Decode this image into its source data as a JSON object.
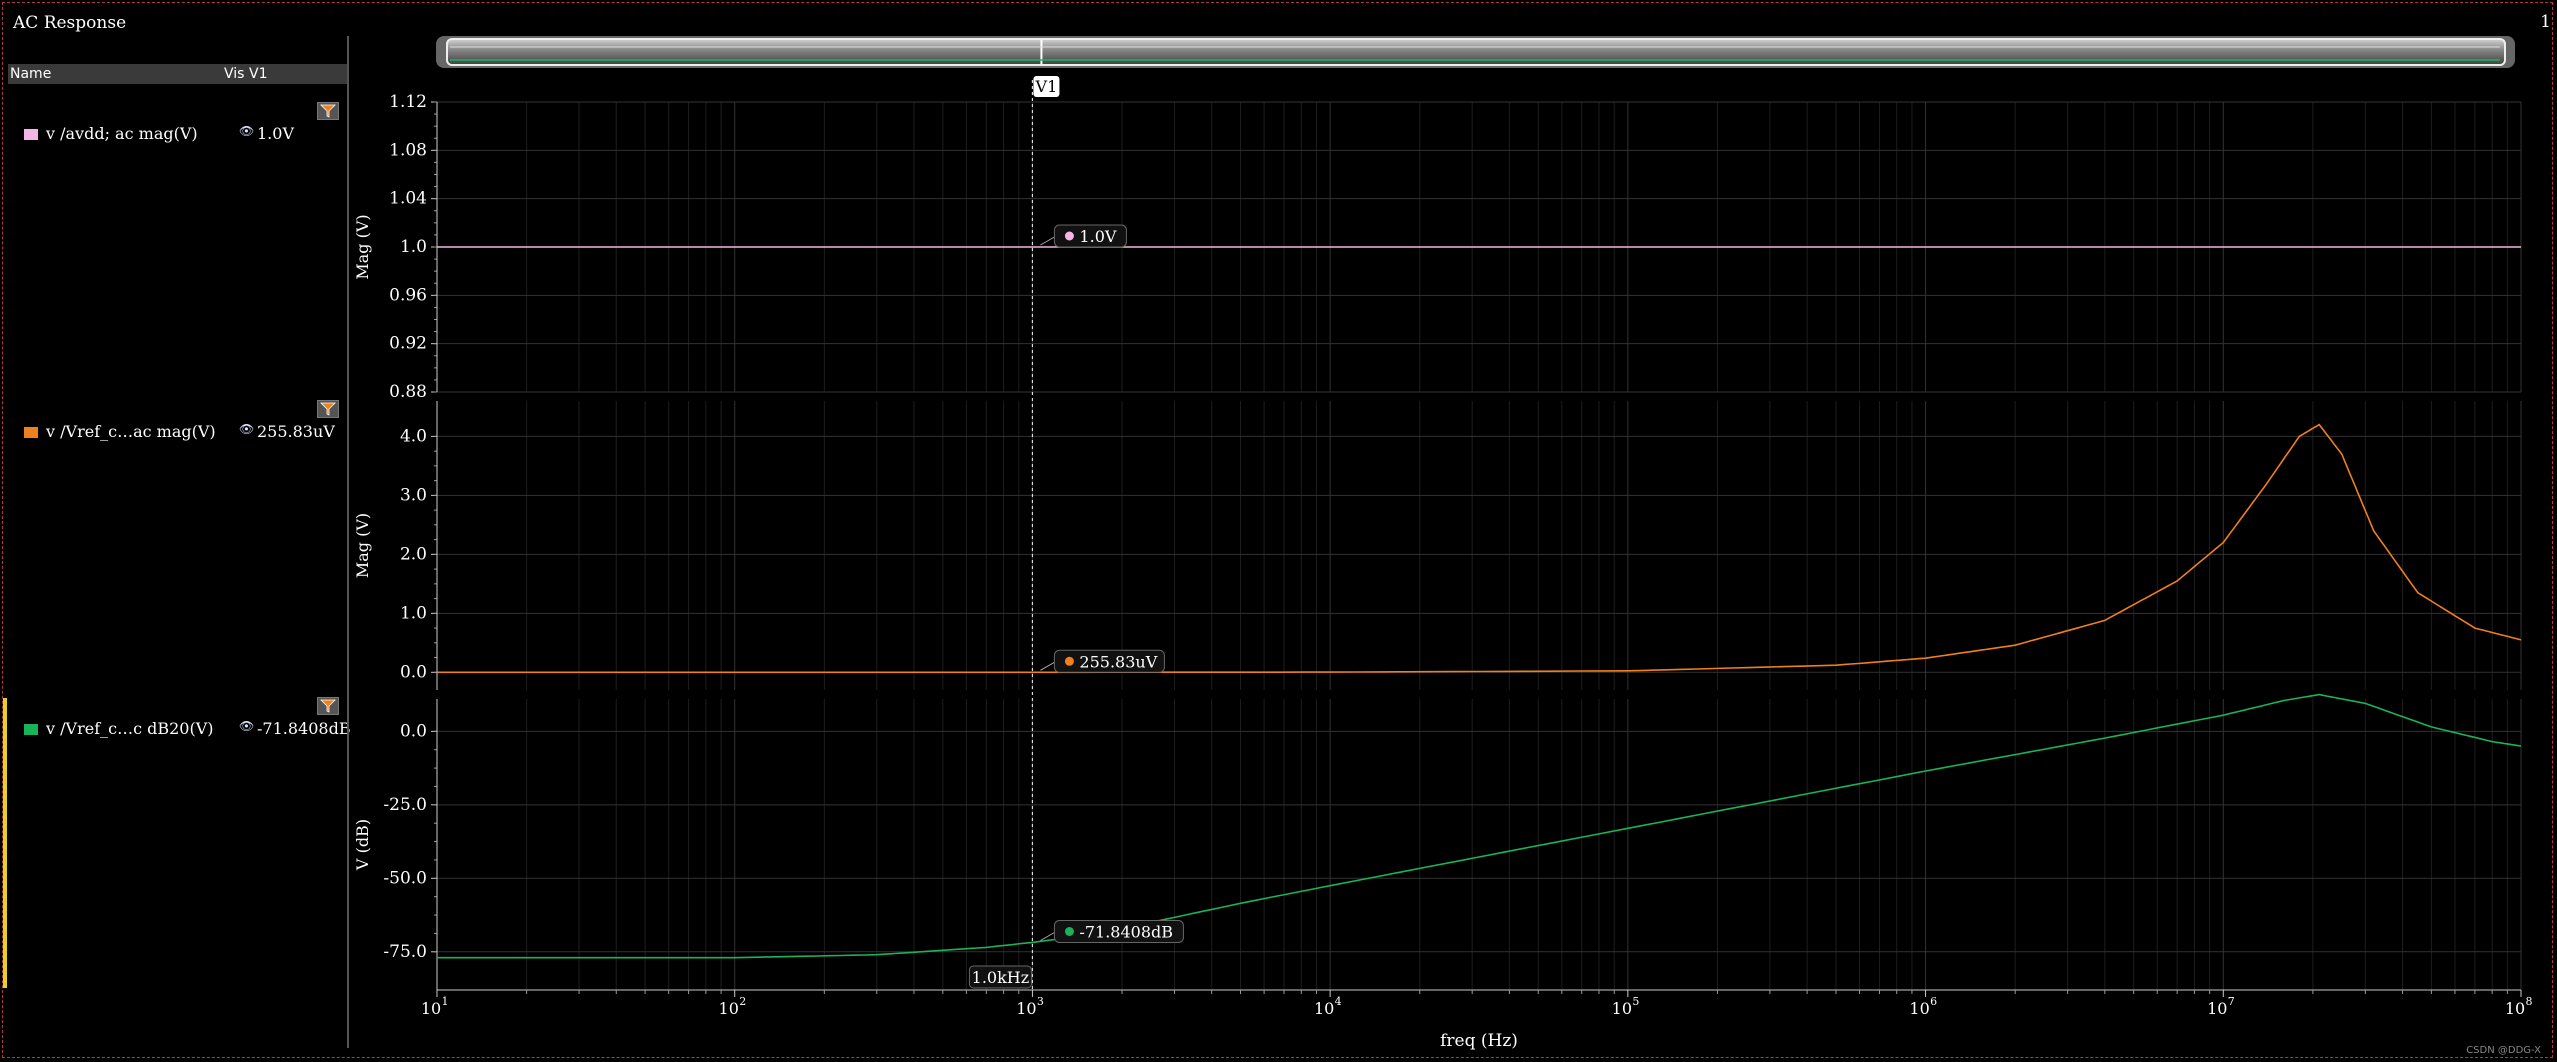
{
  "window": {
    "title": "AC Response",
    "index": "1"
  },
  "panel": {
    "headers": {
      "name": "Name",
      "vis": "Vis",
      "cursor": "V1"
    },
    "signals": [
      {
        "name": "v /avdd; ac mag(V)",
        "value": "1.0V",
        "color": "#f4b6e6"
      },
      {
        "name": "v /Vref_c…ac mag(V)",
        "value": "255.83uV",
        "color": "#f07f1e"
      },
      {
        "name": "v /Vref_c…c dB20(V)",
        "value": "-71.8408dB",
        "color": "#19b35a"
      }
    ]
  },
  "cursor": {
    "name": "V1",
    "x_label": "1.0kHz",
    "x_value": 1000
  },
  "chart_data": [
    {
      "type": "line",
      "ylabel": "Mag (V)",
      "xlabel": "",
      "xscale": "log",
      "xlim": [
        10,
        100000000
      ],
      "ylim": [
        0.88,
        1.12
      ],
      "yticks": [
        "1.12",
        "1.08",
        "1.04",
        "1.0",
        "0.96",
        "0.92",
        "0.88"
      ],
      "ytick_values": [
        1.12,
        1.08,
        1.04,
        1.0,
        0.96,
        0.92,
        0.88
      ],
      "series": [
        {
          "name": "v /avdd; ac mag(V)",
          "color": "#f4b6e6",
          "x": [
            10,
            100,
            1000,
            10000,
            100000,
            1000000,
            10000000,
            100000000
          ],
          "y": [
            1.0,
            1.0,
            1.0,
            1.0,
            1.0,
            1.0,
            1.0,
            1.0
          ]
        }
      ],
      "marker": {
        "label": "1.0V",
        "x": 1000,
        "y": 1.0
      }
    },
    {
      "type": "line",
      "ylabel": "Mag (V)",
      "xlabel": "",
      "xscale": "log",
      "xlim": [
        10,
        100000000
      ],
      "ylim": [
        -0.3,
        4.6
      ],
      "yticks": [
        "4.0",
        "3.0",
        "2.0",
        "1.0",
        "0.0"
      ],
      "ytick_values": [
        4.0,
        3.0,
        2.0,
        1.0,
        0.0
      ],
      "series": [
        {
          "name": "v /Vref_c…ac mag(V)",
          "color": "#f07f1e",
          "x": [
            10,
            1000,
            10000,
            100000,
            500000,
            1000000,
            2000000,
            4000000,
            7000000,
            10000000,
            14000000,
            18000000,
            21000000,
            25000000,
            32000000,
            45000000,
            70000000,
            100000000
          ],
          "y": [
            0.0002,
            0.0003,
            0.003,
            0.025,
            0.12,
            0.24,
            0.46,
            0.88,
            1.55,
            2.2,
            3.2,
            4.0,
            4.2,
            3.7,
            2.4,
            1.35,
            0.75,
            0.55
          ]
        }
      ],
      "marker": {
        "label": "255.83uV",
        "x": 1000,
        "y": 0.00026
      }
    },
    {
      "type": "line",
      "ylabel": "V (dB)",
      "xlabel": "freq (Hz)",
      "xscale": "log",
      "xlim": [
        10,
        100000000
      ],
      "ylim": [
        -88,
        11
      ],
      "yticks": [
        "0.0",
        "-25.0",
        "-50.0",
        "-75.0"
      ],
      "ytick_values": [
        0,
        -25,
        -50,
        -75
      ],
      "xticks": [
        "10^1",
        "10^2",
        "10^3",
        "10^4",
        "10^5",
        "10^6",
        "10^7",
        "10^8"
      ],
      "series": [
        {
          "name": "v /Vref_c…c dB20(V)",
          "color": "#19b35a",
          "x": [
            10,
            100,
            300,
            700,
            1000,
            1500,
            2500,
            5000,
            10000,
            100000,
            1000000,
            4000000,
            10000000,
            16000000,
            21000000,
            30000000,
            50000000,
            80000000,
            100000000
          ],
          "y": [
            -77,
            -77,
            -76,
            -73.5,
            -71.8,
            -69.5,
            -65,
            -58.5,
            -52.5,
            -33,
            -13.5,
            -2.3,
            5.5,
            10.5,
            12.5,
            9.5,
            1.5,
            -3.5,
            -5
          ]
        }
      ],
      "marker": {
        "label": "-71.8408dB",
        "x": 1000,
        "y": -71.84
      }
    }
  ],
  "watermark": "CSDN @DDG-X"
}
